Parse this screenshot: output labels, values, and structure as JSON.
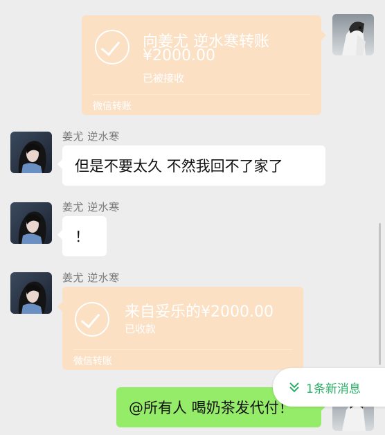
{
  "messages": [
    {
      "type": "transfer",
      "direction": "outgoing",
      "title": "向姜尤 逆水寒转账",
      "amount": "¥2000.00",
      "status": "已被接收",
      "footer": "微信转账"
    },
    {
      "type": "text",
      "direction": "incoming",
      "sender": "姜尤 逆水寒",
      "text": "但是不要太久 不然我回不了家了"
    },
    {
      "type": "text",
      "direction": "incoming",
      "sender": "姜尤 逆水寒",
      "text": "！"
    },
    {
      "type": "transfer",
      "direction": "incoming",
      "sender": "姜尤 逆水寒",
      "title": "来自妥乐的¥2000.00",
      "status": "已收款",
      "footer": "微信转账"
    },
    {
      "type": "text",
      "direction": "outgoing",
      "text": "@所有人 喝奶茶发代付！"
    }
  ],
  "new_messages_badge": {
    "label": "1条新消息",
    "icon": "double-chevron-down-icon",
    "color": "#2aae67"
  },
  "colors": {
    "background": "#ededed",
    "transfer_card": "#fbe0c4",
    "outgoing_bubble": "#95ec69",
    "incoming_bubble": "#ffffff"
  }
}
